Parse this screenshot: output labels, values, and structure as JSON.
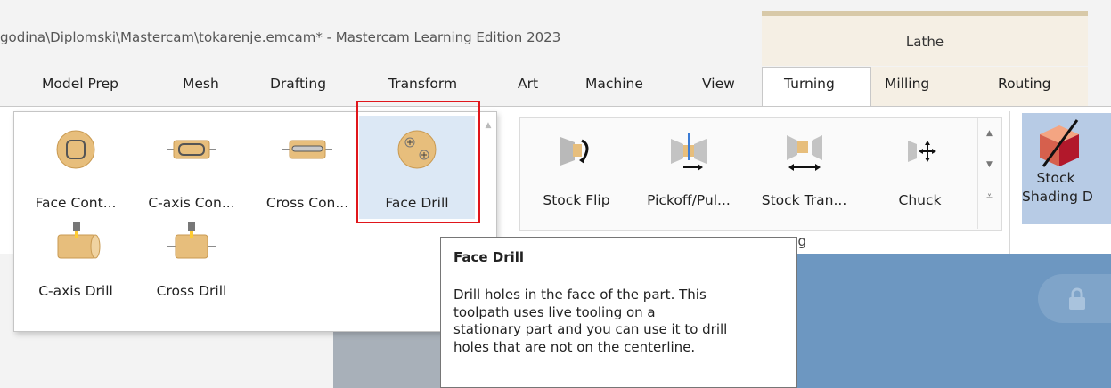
{
  "window": {
    "title": "godina\\Diplomski\\Mastercam\\tokarenje.emcam* - Mastercam Learning Edition 2023",
    "context_tab": "Lathe"
  },
  "tabs": [
    {
      "label": "Model Prep"
    },
    {
      "label": "Mesh"
    },
    {
      "label": "Drafting"
    },
    {
      "label": "Transform"
    },
    {
      "label": "Art"
    },
    {
      "label": "Machine"
    },
    {
      "label": "View"
    },
    {
      "label": "Turning",
      "active": true
    },
    {
      "label": "Milling"
    },
    {
      "label": "Routing"
    }
  ],
  "dropdown_gallery": {
    "items": [
      {
        "label": "Face Cont...",
        "icon": "face-contour-icon"
      },
      {
        "label": "C-axis Con...",
        "icon": "c-axis-contour-icon"
      },
      {
        "label": "Cross Con...",
        "icon": "cross-contour-icon"
      },
      {
        "label": "Face Drill",
        "icon": "face-drill-icon",
        "selected": true
      },
      {
        "label": "C-axis Drill",
        "icon": "c-axis-drill-icon"
      },
      {
        "label": "Cross Drill",
        "icon": "cross-drill-icon"
      }
    ]
  },
  "ribbon_group": {
    "buttons": [
      {
        "label": "Stock Flip",
        "icon": "stock-flip-icon"
      },
      {
        "label": "Pickoff/Pul...",
        "icon": "pickoff-pull-icon"
      },
      {
        "label": "Stock Tran...",
        "icon": "stock-transfer-icon"
      },
      {
        "label": "Chuck",
        "icon": "chuck-icon"
      }
    ],
    "label_fragment": "ng"
  },
  "stock_shading": {
    "line1": "Stock",
    "line2": "Shading D"
  },
  "tooltip": {
    "title": "Face Drill",
    "lines": [
      "Drill holes in the face of the part. This",
      "toolpath uses live tooling on a",
      "stationary part and you can use it to drill",
      "holes that are not on the centerline."
    ]
  },
  "colors": {
    "accent_red": "#e0161b",
    "canvas_blue": "#6d97c1",
    "selected_bg": "#dce8f5",
    "lathe_tab_bg": "#f5efe4"
  }
}
